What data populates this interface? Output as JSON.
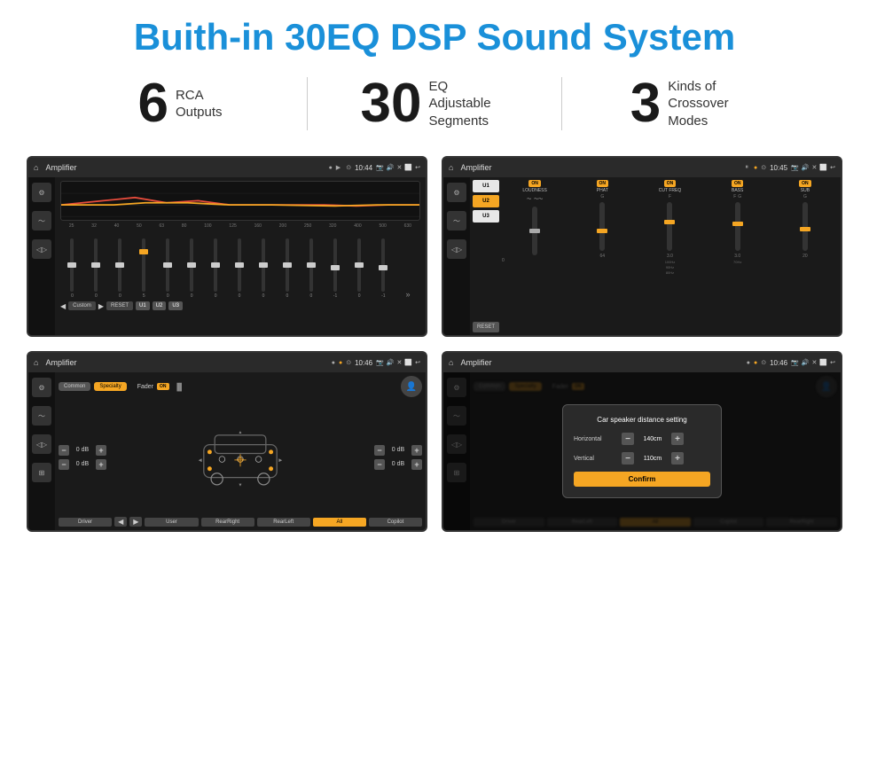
{
  "header": {
    "title": "Buith-in 30EQ DSP Sound System"
  },
  "stats": [
    {
      "number": "6",
      "label": "RCA\nOutputs"
    },
    {
      "number": "30",
      "label": "EQ Adjustable\nSegments"
    },
    {
      "number": "3",
      "label": "Kinds of\nCrossover Modes"
    }
  ],
  "screens": {
    "screen1": {
      "bar": {
        "title": "Amplifier",
        "time": "10:44"
      },
      "eq_labels": [
        "25",
        "32",
        "40",
        "50",
        "63",
        "80",
        "100",
        "125",
        "160",
        "200",
        "250",
        "320",
        "400",
        "500",
        "630"
      ],
      "eq_values": [
        "0",
        "0",
        "0",
        "5",
        "0",
        "0",
        "0",
        "0",
        "0",
        "0",
        "0",
        "-1",
        "0",
        "-1"
      ],
      "presets": [
        "Custom",
        "RESET",
        "U1",
        "U2",
        "U3"
      ]
    },
    "screen2": {
      "bar": {
        "title": "Amplifier",
        "time": "10:45"
      },
      "presets": [
        "U1",
        "U2",
        "U3"
      ],
      "controls": [
        "LOUDNESS",
        "PHAT",
        "CUT FREQ",
        "BASS",
        "SUB"
      ],
      "reset": "RESET"
    },
    "screen3": {
      "bar": {
        "title": "Amplifier",
        "time": "10:46"
      },
      "tabs": [
        "Common",
        "Specialty"
      ],
      "fader": "Fader",
      "fader_on": "ON",
      "db_rows": [
        "0 dB",
        "0 dB",
        "0 dB",
        "0 dB"
      ],
      "bottom_btns": [
        "Driver",
        "",
        "",
        "User",
        "RearRight",
        "RearLeft",
        "All",
        "Copilot"
      ]
    },
    "screen4": {
      "bar": {
        "title": "Amplifier",
        "time": "10:46"
      },
      "tabs": [
        "Common",
        "Specialty"
      ],
      "dialog": {
        "title": "Car speaker distance setting",
        "fields": [
          {
            "label": "Horizontal",
            "value": "140cm"
          },
          {
            "label": "Vertical",
            "value": "110cm"
          }
        ],
        "confirm": "Confirm"
      },
      "bottom_btns": [
        "Driver",
        "RearLeft",
        "All",
        "User",
        "RearRight",
        "Copilot"
      ]
    }
  }
}
